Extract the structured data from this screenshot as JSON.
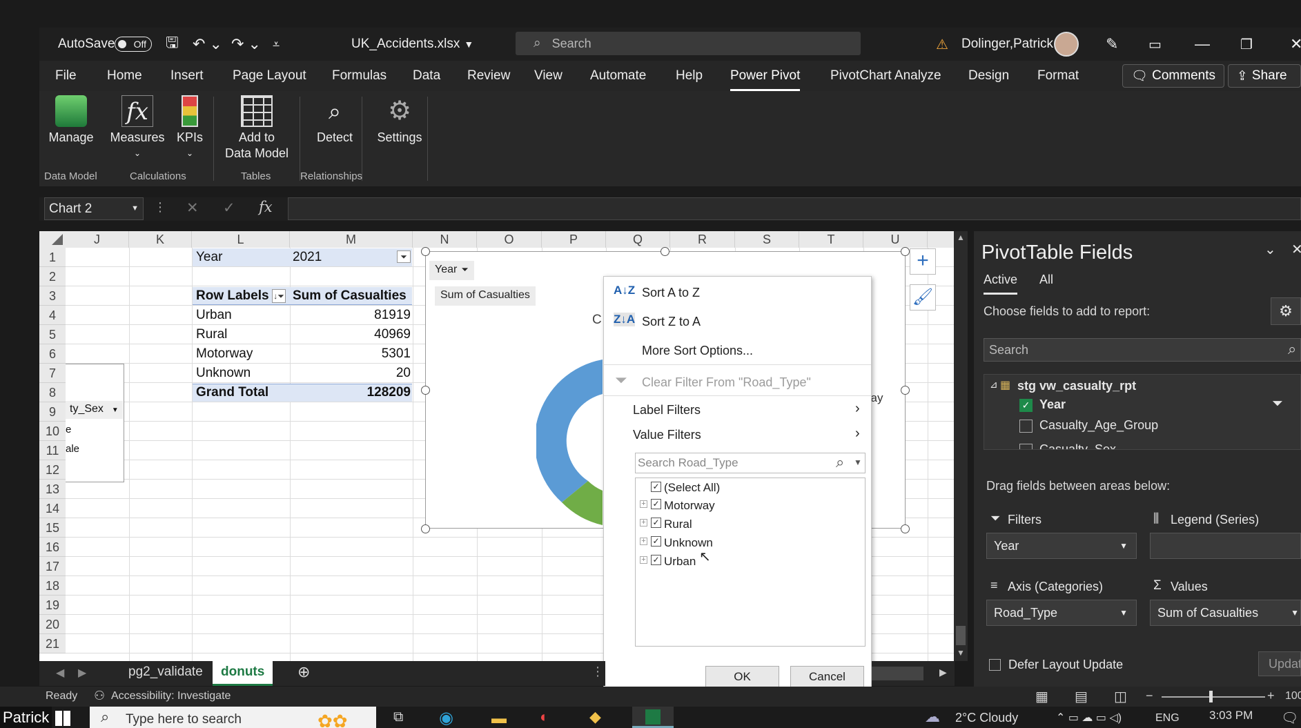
{
  "window": {
    "autosave_label": "AutoSave",
    "autosave_state": "Off",
    "filename": "UK_Accidents.xlsx",
    "search_placeholder": "Search",
    "user": "Dolinger,Patrick"
  },
  "menu": {
    "tabs": [
      "File",
      "Home",
      "Insert",
      "Page Layout",
      "Formulas",
      "Data",
      "Review",
      "View",
      "Automate",
      "Help",
      "Power Pivot",
      "PivotChart Analyze",
      "Design",
      "Format"
    ],
    "active": "Power Pivot",
    "comments": "Comments",
    "share": "Share"
  },
  "ribbon": {
    "manage": "Manage",
    "measures": "Measures",
    "kpis": "KPIs",
    "add_to_data_model_1": "Add to",
    "add_to_data_model_2": "Data Model",
    "detect": "Detect",
    "settings": "Settings",
    "groups": [
      "Data Model",
      "Calculations",
      "Tables",
      "Relationships"
    ]
  },
  "formula_bar": {
    "name_box": "Chart 2",
    "fx": "fx"
  },
  "grid": {
    "columns": [
      "J",
      "K",
      "L",
      "M",
      "N",
      "O",
      "P",
      "Q",
      "R",
      "S",
      "T",
      "U"
    ],
    "rows": [
      "1",
      "2",
      "3",
      "4",
      "5",
      "6",
      "7",
      "8",
      "9",
      "10",
      "11",
      "12",
      "13",
      "14",
      "15",
      "16",
      "17",
      "18",
      "19",
      "20",
      "21"
    ],
    "year_label": "Year",
    "year_value": "2021",
    "row_labels_header": "Row Labels",
    "sum_header": "Sum of Casualties",
    "pivot_rows": [
      {
        "label": "Urban",
        "value": "81919"
      },
      {
        "label": "Rural",
        "value": "40969"
      },
      {
        "label": "Motorway",
        "value": "5301"
      },
      {
        "label": "Unknown",
        "value": "20"
      }
    ],
    "grand_total_label": "Grand Total",
    "grand_total_value": "128209",
    "left_fragment_1": "ty_Sex",
    "left_fragment_2": "e",
    "left_fragment_3": "ale"
  },
  "chart": {
    "filter_year": "Year",
    "sum_button": "Sum of Casualties",
    "title_fragment": "C",
    "legend_fragment": "vay",
    "field_fragment": "e"
  },
  "dropdown": {
    "sort_az": "Sort A to Z",
    "sort_za": "Sort Z to A",
    "more_sort": "More Sort Options...",
    "clear_filter": "Clear Filter From \"Road_Type\"",
    "label_filters": "Label Filters",
    "value_filters": "Value Filters",
    "search_placeholder": "Search Road_Type",
    "items": [
      "(Select All)",
      "Motorway",
      "Rural",
      "Unknown",
      "Urban"
    ],
    "ok": "OK",
    "cancel": "Cancel"
  },
  "pivot_pane": {
    "title": "PivotTable Fields",
    "tab_active": "Active",
    "tab_all": "All",
    "choose": "Choose fields to add to report:",
    "search": "Search",
    "table": "stg vw_casualty_rpt",
    "fields": [
      {
        "name": "Year",
        "checked": true
      },
      {
        "name": "Casualty_Age_Group",
        "checked": false
      },
      {
        "name": "Casualty_Sex",
        "checked": false
      }
    ],
    "drag_text": "Drag fields between areas below:",
    "filters_label": "Filters",
    "legend_label": "Legend (Series)",
    "filters_value": "Year",
    "axis_label": "Axis (Categories)",
    "values_label": "Values",
    "axis_value": "Road_Type",
    "values_value": "Sum of Casualties",
    "defer": "Defer Layout Update",
    "update": "Update"
  },
  "sheets": {
    "tabs": [
      "pg2_validate",
      "donuts"
    ],
    "active": "donuts"
  },
  "status": {
    "ready": "Ready",
    "accessibility": "Accessibility: Investigate",
    "zoom": "100"
  },
  "taskbar": {
    "user_label": "Patrick",
    "search": "Type here to search",
    "weather": "2°C  Cloudy",
    "lang": "ENG",
    "time": "3:03 PM"
  }
}
